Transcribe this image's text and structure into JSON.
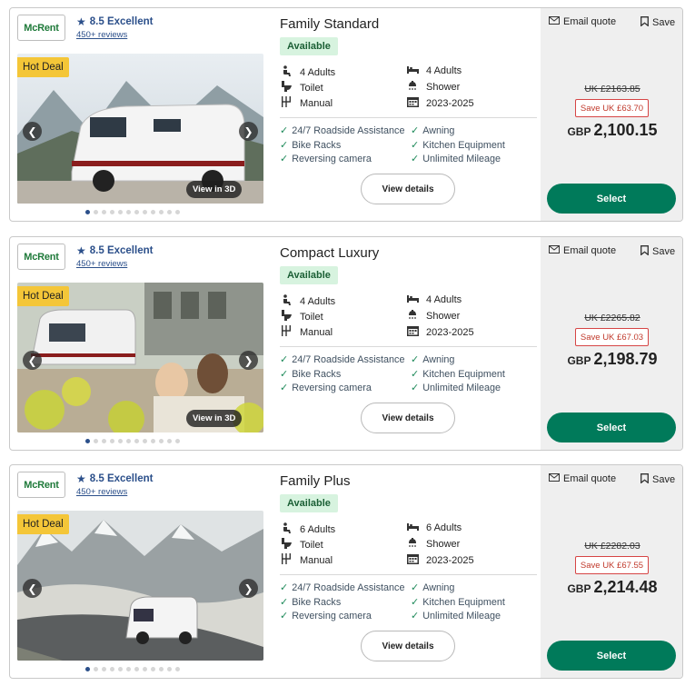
{
  "listings": [
    {
      "brand": "McRent",
      "rating": "8.5 Excellent",
      "reviews": "450+ reviews",
      "hot_deal": "Hot Deal",
      "view_3d": "View in 3D",
      "photo_count": 12,
      "active_photo": 0,
      "title": "Family Standard",
      "availability": "Available",
      "specs": {
        "seats": "4 Adults",
        "beds": "4 Adults",
        "toilet": "Toilet",
        "shower": "Shower",
        "transmission": "Manual",
        "year": "2023-2025"
      },
      "features": [
        "24/7 Roadside Assistance",
        "Awning",
        "Bike Racks",
        "Kitchen Equipment",
        "Reversing camera",
        "Unlimited Mileage"
      ],
      "details_label": "View details",
      "email_label": "Email quote",
      "save_label": "Save",
      "old_price": "UK £2163.85",
      "saving": "Save UK £63.70",
      "currency": "GBP",
      "price": "2,100.15",
      "select_label": "Select"
    },
    {
      "brand": "McRent",
      "rating": "8.5 Excellent",
      "reviews": "450+ reviews",
      "hot_deal": "Hot Deal",
      "view_3d": "View in 3D",
      "photo_count": 12,
      "active_photo": 0,
      "title": "Compact Luxury",
      "availability": "Available",
      "specs": {
        "seats": "4 Adults",
        "beds": "4 Adults",
        "toilet": "Toilet",
        "shower": "Shower",
        "transmission": "Manual",
        "year": "2023-2025"
      },
      "features": [
        "24/7 Roadside Assistance",
        "Awning",
        "Bike Racks",
        "Kitchen Equipment",
        "Reversing camera",
        "Unlimited Mileage"
      ],
      "details_label": "View details",
      "email_label": "Email quote",
      "save_label": "Save",
      "old_price": "UK £2265.82",
      "saving": "Save UK £67.03",
      "currency": "GBP",
      "price": "2,198.79",
      "select_label": "Select"
    },
    {
      "brand": "McRent",
      "rating": "8.5 Excellent",
      "reviews": "450+ reviews",
      "hot_deal": "Hot Deal",
      "view_3d": "",
      "photo_count": 12,
      "active_photo": 0,
      "title": "Family Plus",
      "availability": "Available",
      "specs": {
        "seats": "6 Adults",
        "beds": "6 Adults",
        "toilet": "Toilet",
        "shower": "Shower",
        "transmission": "Manual",
        "year": "2023-2025"
      },
      "features": [
        "24/7 Roadside Assistance",
        "Awning",
        "Bike Racks",
        "Kitchen Equipment",
        "Reversing camera",
        "Unlimited Mileage"
      ],
      "details_label": "View details",
      "email_label": "Email quote",
      "save_label": "Save",
      "old_price": "UK £2282.03",
      "saving": "Save UK £67.55",
      "currency": "GBP",
      "price": "2,214.48",
      "select_label": "Select"
    }
  ],
  "colors": {
    "select_button": "#007a5a",
    "hot_deal": "#f4c638",
    "available_bg": "#d7f3df",
    "save_badge": "#d64545",
    "link": "#2b4f8a",
    "check": "#1f8a5a"
  },
  "icons": {
    "seats": "seat-icon",
    "beds": "bed-icon",
    "toilet": "toilet-icon",
    "shower": "shower-icon",
    "transmission": "gearbox-icon",
    "year": "calendar-icon",
    "email": "envelope-icon",
    "save": "bookmark-icon",
    "rating": "star-icon",
    "feature": "checkmark-icon"
  }
}
